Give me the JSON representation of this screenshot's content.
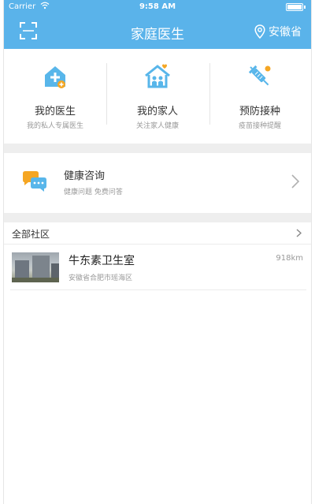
{
  "status_bar": {
    "carrier": "Carrier",
    "time": "9:58 AM"
  },
  "header": {
    "title": "家庭医生",
    "location": "安徽省",
    "background": "#5ab3ea"
  },
  "quick_actions": [
    {
      "title": "我的医生",
      "subtitle": "我的私人专属医生",
      "icon": "doctor-house-icon"
    },
    {
      "title": "我的家人",
      "subtitle": "关注家人健康",
      "icon": "family-house-icon"
    },
    {
      "title": "预防接种",
      "subtitle": "疫苗接种提醒",
      "icon": "vaccine-syringe-icon"
    }
  ],
  "consult": {
    "title": "健康咨询",
    "subtitle": "健康问题 免费问答",
    "icon": "chat-bubbles-icon"
  },
  "community": {
    "section_title": "全部社区",
    "items": [
      {
        "name": "牛东素卫生室",
        "distance": "918km",
        "address": "安徽省合肥市瑶海区"
      }
    ]
  },
  "colors": {
    "accent": "#5ab3ea",
    "icon_blue": "#58b6ea",
    "icon_orange": "#f5a623"
  }
}
